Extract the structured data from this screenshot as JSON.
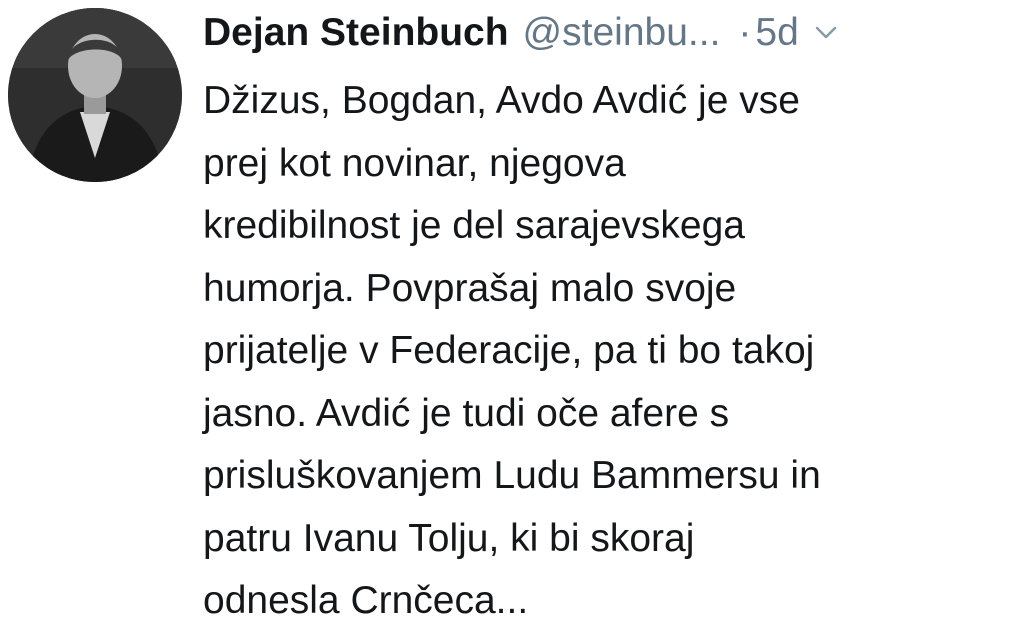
{
  "author": {
    "display_name": "Dejan Steinbuch",
    "handle": "@steinbu...",
    "separator": "·",
    "time": "5d",
    "avatar_icon": "user-photo"
  },
  "menu": {
    "icon": "chevron-down-icon"
  },
  "tweet": {
    "lines": [
      "Džizus, Bogdan, Avdo Avdić je vse",
      "prej kot novinar, njegova",
      "kredibilnost je del sarajevskega",
      "humorja. Povprašaj malo svoje",
      "prijatelje v Federacije, pa ti bo takoj",
      "jasno. Avdić je tudi oče afere s",
      "prisluškovanjem Ludu Bammersu in",
      "patru Ivanu Tolju, ki bi skoraj",
      "odnesla Crnčeca..."
    ]
  },
  "colors": {
    "text": "#14171a",
    "secondary": "#657786",
    "background": "#ffffff"
  }
}
